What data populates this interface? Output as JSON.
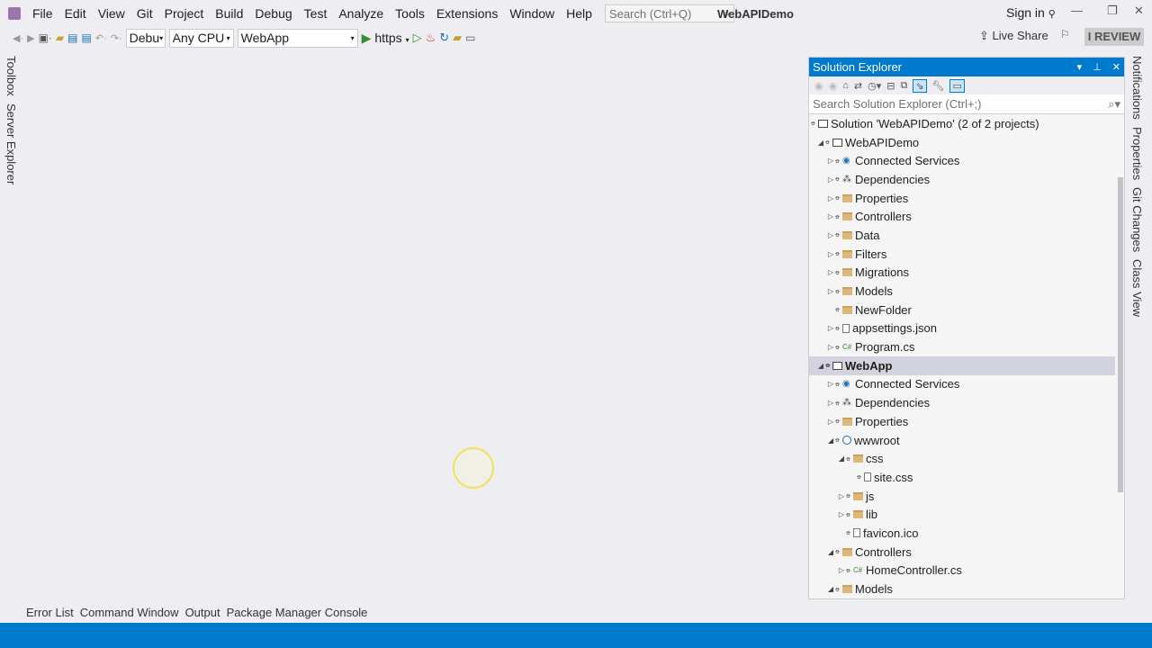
{
  "menu": [
    "File",
    "Edit",
    "View",
    "Git",
    "Project",
    "Build",
    "Debug",
    "Test",
    "Analyze",
    "Tools",
    "Extensions",
    "Window",
    "Help"
  ],
  "quick_search_placeholder": "Search (Ctrl+Q)",
  "window_title": "WebAPIDemo",
  "sign_in": "Sign in",
  "toolbar": {
    "config": "Debu",
    "platform": "Any CPU",
    "startup": "WebApp",
    "run": "https"
  },
  "live_share": "Live Share",
  "review_badge": "I REVIEW",
  "left_tabs": [
    "Toolbox",
    "Server Explorer"
  ],
  "right_tabs": [
    "Notifications",
    "Properties",
    "Git Changes",
    "Class View"
  ],
  "bottom_tabs": [
    "Error List",
    "Command Window",
    "Output",
    "Package Manager Console"
  ],
  "solution_explorer": {
    "title": "Solution Explorer",
    "search_placeholder": "Search Solution Explorer (Ctrl+;)",
    "items": [
      {
        "label": "Solution 'WebAPIDemo' (2 of 2 projects)",
        "level": 0,
        "icon": "solution",
        "expander": "none"
      },
      {
        "label": "WebAPIDemo",
        "level": 1,
        "icon": "project",
        "expander": "expanded"
      },
      {
        "label": "Connected Services",
        "level": 2,
        "icon": "service",
        "expander": "collapsed"
      },
      {
        "label": "Dependencies",
        "level": 2,
        "icon": "dependencies",
        "expander": "collapsed"
      },
      {
        "label": "Properties",
        "level": 2,
        "icon": "folder",
        "expander": "collapsed"
      },
      {
        "label": "Controllers",
        "level": 2,
        "icon": "folder",
        "expander": "collapsed"
      },
      {
        "label": "Data",
        "level": 2,
        "icon": "folder",
        "expander": "collapsed"
      },
      {
        "label": "Filters",
        "level": 2,
        "icon": "folder",
        "expander": "collapsed"
      },
      {
        "label": "Migrations",
        "level": 2,
        "icon": "folder",
        "expander": "collapsed"
      },
      {
        "label": "Models",
        "level": 2,
        "icon": "folder",
        "expander": "collapsed"
      },
      {
        "label": "NewFolder",
        "level": 2,
        "icon": "folder",
        "expander": "none"
      },
      {
        "label": "appsettings.json",
        "level": 2,
        "icon": "file",
        "expander": "collapsed"
      },
      {
        "label": "Program.cs",
        "level": 2,
        "icon": "csharp",
        "expander": "collapsed"
      },
      {
        "label": "WebApp",
        "level": 1,
        "icon": "project",
        "expander": "expanded",
        "selected": true
      },
      {
        "label": "Connected Services",
        "level": 2,
        "icon": "service",
        "expander": "collapsed"
      },
      {
        "label": "Dependencies",
        "level": 2,
        "icon": "dependencies",
        "expander": "collapsed"
      },
      {
        "label": "Properties",
        "level": 2,
        "icon": "folder",
        "expander": "collapsed"
      },
      {
        "label": "wwwroot",
        "level": 2,
        "icon": "globe",
        "expander": "expanded"
      },
      {
        "label": "css",
        "level": 3,
        "icon": "folder",
        "expander": "expanded"
      },
      {
        "label": "site.css",
        "level": 4,
        "icon": "file",
        "expander": "none"
      },
      {
        "label": "js",
        "level": 3,
        "icon": "folder",
        "expander": "collapsed"
      },
      {
        "label": "lib",
        "level": 3,
        "icon": "folder",
        "expander": "collapsed"
      },
      {
        "label": "favicon.ico",
        "level": 3,
        "icon": "file",
        "expander": "none"
      },
      {
        "label": "Controllers",
        "level": 2,
        "icon": "folder",
        "expander": "expanded"
      },
      {
        "label": "HomeController.cs",
        "level": 3,
        "icon": "csharp",
        "expander": "collapsed"
      },
      {
        "label": "Models",
        "level": 2,
        "icon": "folder",
        "expander": "expanded"
      }
    ]
  },
  "colors": {
    "accent": "#007acc",
    "background": "#eeeef2",
    "selection": "#d3d3e0"
  }
}
